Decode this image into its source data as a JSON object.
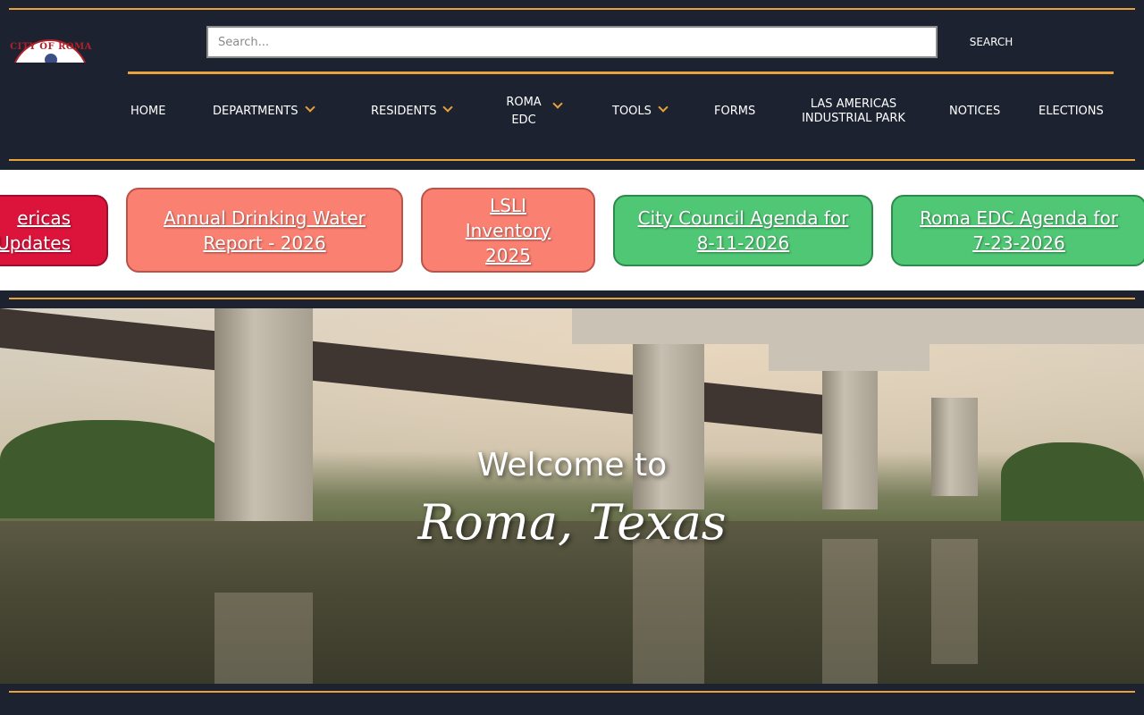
{
  "header": {
    "logo_text": "CITY OF ROMA",
    "search": {
      "placeholder": "Search...",
      "value": "",
      "button_label": "SEARCH"
    },
    "nav": [
      {
        "label": "HOME"
      },
      {
        "label": "DEPARTMENTS",
        "dropdown": true
      },
      {
        "label": "RESIDENTS",
        "dropdown": true
      },
      {
        "label_line1": "ROMA",
        "label_line2": "EDC",
        "dropdown": true
      },
      {
        "label": "TOOLS",
        "dropdown": true
      },
      {
        "label": "FORMS"
      },
      {
        "label_line1": "LAS AMERICAS",
        "label_line2": "INDUSTRIAL PARK"
      },
      {
        "label": "NOTICES"
      },
      {
        "label": "ELECTIONS"
      }
    ]
  },
  "notices": [
    {
      "line1": "ericas",
      "line2": "Updates",
      "color": "#dc143c"
    },
    {
      "line1": "Annual Drinking Water",
      "line2": "Report - 2026",
      "color": "#fa8072"
    },
    {
      "line1": "LSLI",
      "line2": "Inventory",
      "line3": "2025",
      "color": "#fa8072"
    },
    {
      "line1": "City Council Agenda for",
      "line2": "8-11-2026",
      "color": "#4fc774"
    },
    {
      "line1": "Roma EDC Agenda for",
      "line2": "7-23-2026",
      "color": "#4fc774"
    }
  ],
  "hero": {
    "title": "Welcome to",
    "subtitle": "Roma, Texas"
  },
  "colors": {
    "accent": "#e9a23b",
    "background": "#1c2230"
  }
}
